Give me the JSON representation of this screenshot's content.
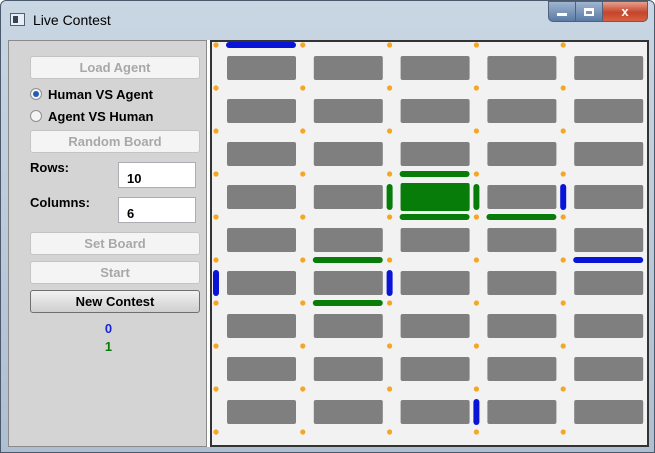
{
  "window": {
    "title": "Live Contest"
  },
  "titlebar": {
    "min_glyph": "",
    "max_glyph": "",
    "close_glyph": "x"
  },
  "left_panel": {
    "load_agent": "Load Agent",
    "modes": [
      {
        "label": "Human VS Agent",
        "checked": true
      },
      {
        "label": "Agent VS Human",
        "checked": false
      }
    ],
    "random_board": "Random Board",
    "rows_label": "Rows:",
    "rows_value": "10",
    "columns_label": "Columns:",
    "columns_value": "6",
    "set_board": "Set Board",
    "start": "Start",
    "new_contest": "New Contest",
    "score_blue": "0",
    "score_green": "1"
  },
  "board": {
    "rows": 9,
    "cols": 5,
    "colors": {
      "background": "#f2f2f2",
      "cell": "#7f7f7f",
      "dot": "#f5a623",
      "blue": "#0a14d6",
      "green": "#087c08"
    },
    "claimed_boxes": [
      {
        "row": 3,
        "col": 2,
        "player": "green"
      }
    ],
    "h_lines": [
      {
        "row": 0,
        "col": 0,
        "player": "blue"
      },
      {
        "row": 3,
        "col": 2,
        "player": "green"
      },
      {
        "row": 4,
        "col": 2,
        "player": "green"
      },
      {
        "row": 4,
        "col": 3,
        "player": "green"
      },
      {
        "row": 5,
        "col": 1,
        "player": "green"
      },
      {
        "row": 5,
        "col": 4,
        "player": "blue"
      },
      {
        "row": 6,
        "col": 1,
        "player": "green"
      }
    ],
    "v_lines": [
      {
        "row": 3,
        "col": 2,
        "player": "green"
      },
      {
        "row": 3,
        "col": 3,
        "player": "green"
      },
      {
        "row": 3,
        "col": 4,
        "player": "blue"
      },
      {
        "row": 5,
        "col": 0,
        "player": "blue"
      },
      {
        "row": 5,
        "col": 2,
        "player": "blue"
      },
      {
        "row": 8,
        "col": 3,
        "player": "blue"
      }
    ]
  }
}
